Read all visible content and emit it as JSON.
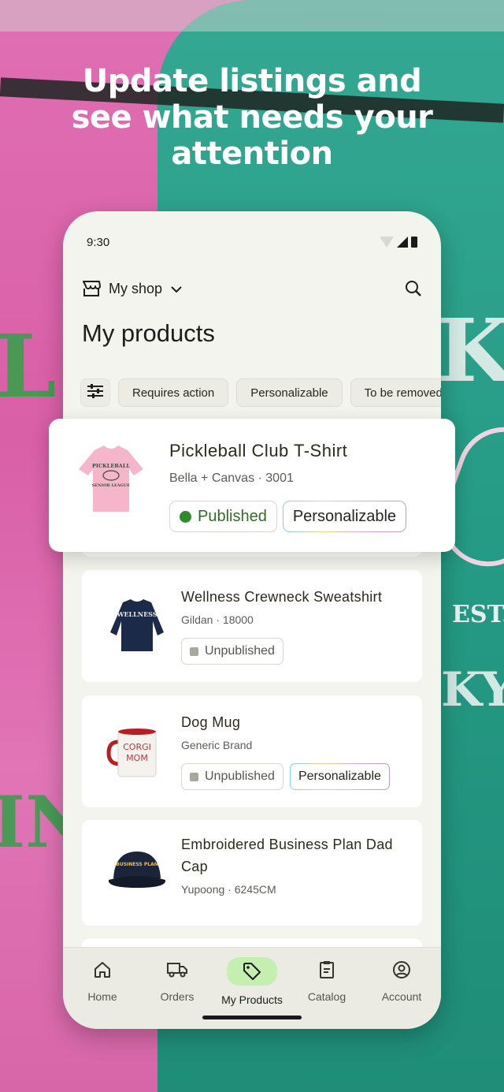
{
  "headline": {
    "line1": "Update listings and",
    "line2": "see what needs your",
    "line3": "attention"
  },
  "background_print": {
    "left_top": "LL",
    "left_bottom": "IN",
    "right_top": "KI",
    "right_est": "EST.",
    "right_bottom": "KYO"
  },
  "status_bar": {
    "time": "9:30"
  },
  "header": {
    "shop_label": "My shop",
    "title": "My products"
  },
  "filters": {
    "chips": [
      "Requires action",
      "Personalizable",
      "To be removed"
    ]
  },
  "highlight_product": {
    "name": "Pickleball Club T-Shirt",
    "sub": "Bella + Canvas · 3001",
    "status": "Published",
    "tag": "Personalizable",
    "thumb_text_top": "PICKLEBALL",
    "thumb_text_bottom": "SENIOR LEAGUE"
  },
  "products": [
    {
      "name": "Wellness Crewneck Sweatshirt",
      "sub": "Gildan · 18000",
      "status": "Unpublished",
      "tag": "",
      "thumb_text": "WELLNESS"
    },
    {
      "name": "Dog Mug",
      "sub": "Generic Brand",
      "status": "Unpublished",
      "tag": "Personalizable",
      "thumb_text_1": "CORGI",
      "thumb_text_2": "MOM"
    },
    {
      "name_line1": "Embroidered Business Plan Dad",
      "name_line2": "Cap",
      "sub": "Yupoong · 6245CM",
      "thumb_text": "BUSINESS PLAN"
    }
  ],
  "bottom_nav": {
    "items": [
      "Home",
      "Orders",
      "My Products",
      "Catalog",
      "Account"
    ],
    "active": "My Products"
  },
  "colors": {
    "accent_active": "#c5eeb1",
    "published": "#2f8a2c",
    "unpublished": "#a8a89f"
  }
}
